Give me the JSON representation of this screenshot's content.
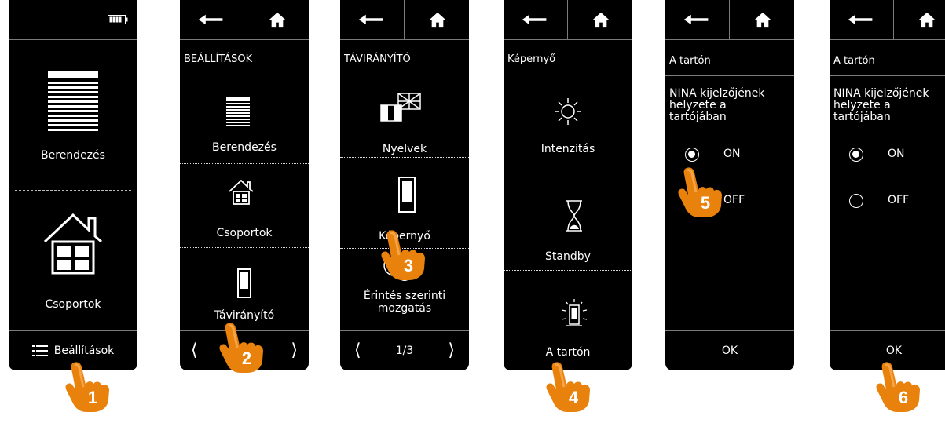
{
  "colors": {
    "screen_bg": "#000000",
    "divider": "#7a7a7a",
    "hand_orange": "#e8820c",
    "hand_light": "#f4a54a"
  },
  "screens": {
    "s1": {
      "battery_icon": "battery-icon",
      "item1": "Berendezés",
      "item2": "Csoportok",
      "menu": "Beállítások",
      "step": "1"
    },
    "s2": {
      "title": "BEÁLLÍTÁSOK",
      "item1": "Berendezés",
      "item2": "Csoportok",
      "item3": "Távirányító",
      "step": "2"
    },
    "s3": {
      "title": "TÁVIRÁNYÍTÓ",
      "item1": "Nyelvek",
      "item2": "Képernyő",
      "item3_line1": "Érintés szerinti",
      "item3_line2": "mozgatás",
      "page": "1/3",
      "step": "3"
    },
    "s4": {
      "title": "Képernyő",
      "item1": "Intenzitás",
      "item2": "Standby",
      "item3": "A tartón",
      "step": "4"
    },
    "s5": {
      "title": "A tartón",
      "text_line1": "NINA kijelzőjének",
      "text_line2": "helyzete a",
      "text_line3": "tartójában",
      "on": "ON",
      "off": "OFF",
      "ok": "OK",
      "step": "5"
    },
    "s6": {
      "title": "A tartón",
      "text_line1": "NINA kijelzőjének",
      "text_line2": "helyzete a",
      "text_line3": "tartójában",
      "on": "ON",
      "off": "OFF",
      "ok": "OK",
      "step": "6"
    }
  }
}
